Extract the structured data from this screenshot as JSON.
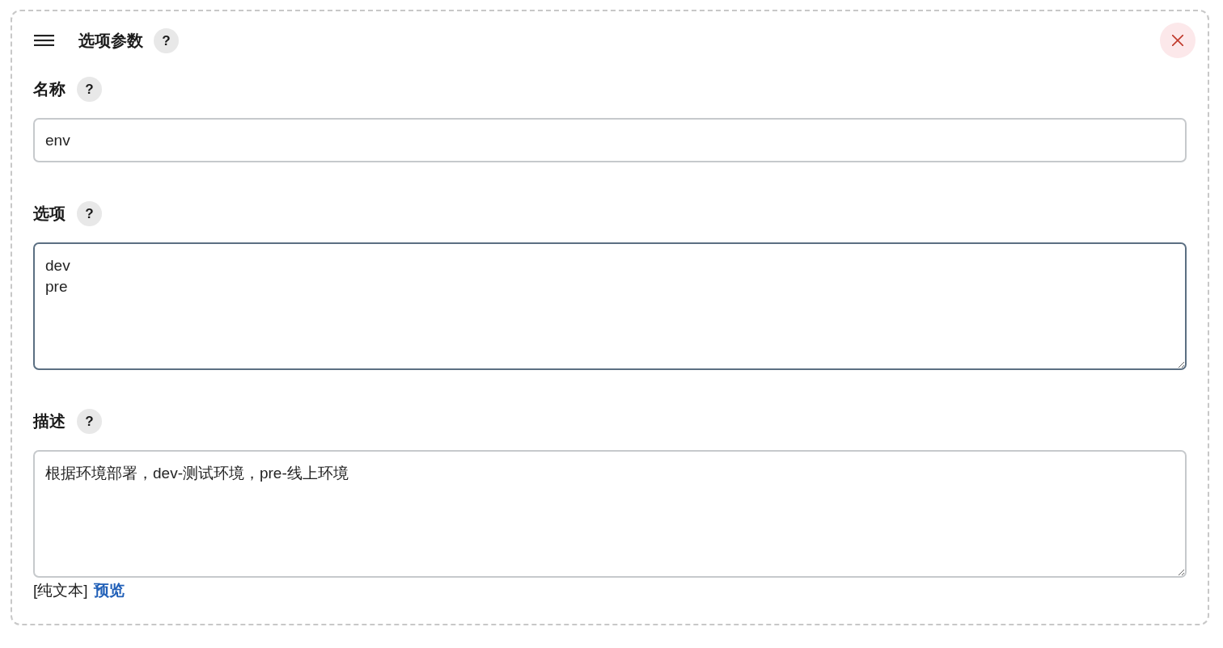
{
  "section": {
    "title": "选项参数",
    "help": "?"
  },
  "fields": [
    {
      "kind": "input",
      "label": "名称",
      "help": "?",
      "value": "env",
      "focused": false
    },
    {
      "kind": "textarea",
      "label": "选项",
      "help": "?",
      "value": "dev\npre",
      "focused": true
    },
    {
      "kind": "textarea",
      "label": "描述",
      "help": "?",
      "value": "根据环境部署，dev-测试环境，pre-线上环境",
      "focused": false
    }
  ],
  "format": {
    "mode": "[纯文本]",
    "preview_link": "预览"
  }
}
